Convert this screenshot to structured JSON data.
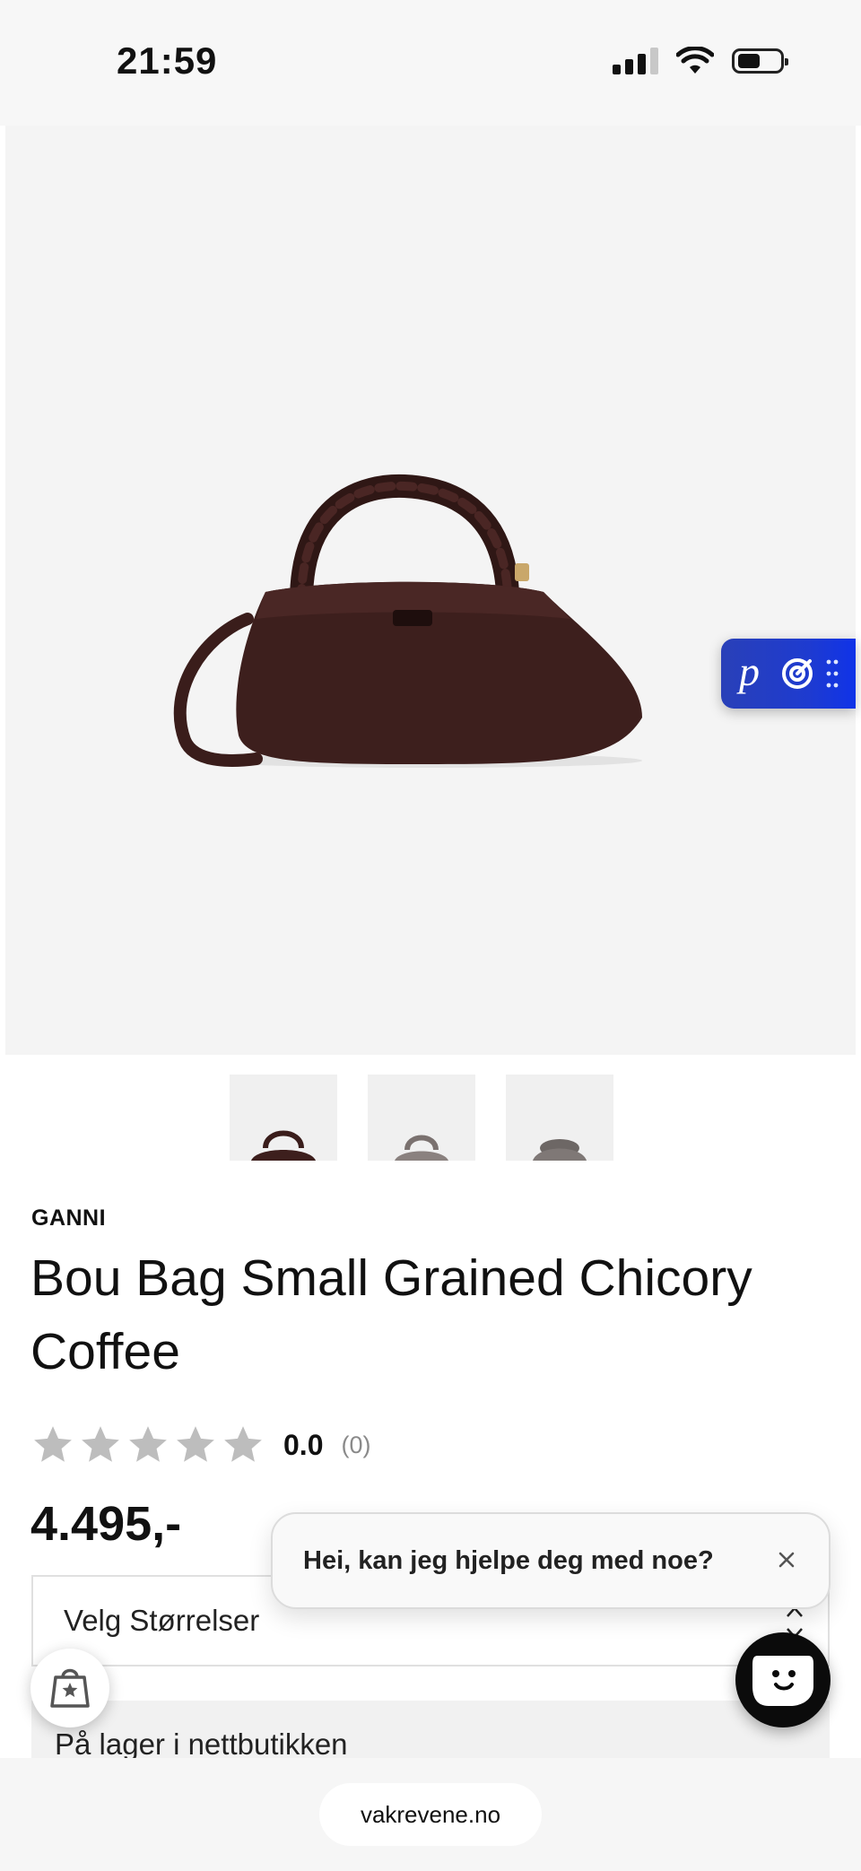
{
  "status_bar": {
    "time": "21:59"
  },
  "product": {
    "brand": "GANNI",
    "title": "Bou Bag Small Grained Chicory Coffee",
    "rating_value": "0.0",
    "rating_count": "(0)",
    "rating_stars": 0,
    "price": "4.495,-"
  },
  "size_select": {
    "label": "Velg Størrelser"
  },
  "stock": {
    "label": "På lager i nettbutikken"
  },
  "chat": {
    "message": "Hei, kan jeg hjelpe deg med noe?"
  },
  "browser": {
    "url": "vakrevene.no"
  },
  "badge": {
    "letter": "p"
  },
  "icons": {
    "signal": "cellular-signal-icon",
    "wifi": "wifi-icon",
    "battery": "battery-icon",
    "close": "close-icon",
    "chat": "chat-face-icon",
    "rewards": "shopping-bag-star-icon",
    "chevron": "up-down-chevron-icon",
    "star": "star-icon",
    "target": "target-icon",
    "drag": "drag-handle-icon"
  },
  "colors": {
    "product_bag": "#3d1f1d",
    "badge_blue": "#1e3bd0",
    "star_empty": "#bdbdbd"
  }
}
